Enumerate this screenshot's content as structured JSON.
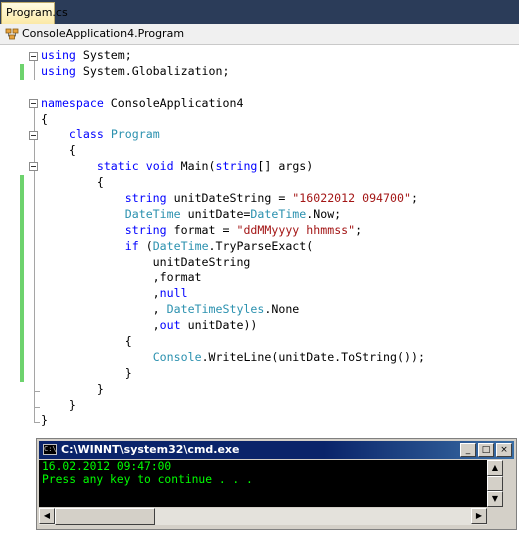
{
  "tab": {
    "label": "Program.cs"
  },
  "navbar": {
    "class_path": "ConsoleApplication4.Program"
  },
  "code_lines": [
    [
      {
        "t": "using",
        "c": "kw"
      },
      {
        "t": " System;"
      }
    ],
    [
      {
        "t": "using",
        "c": "kw"
      },
      {
        "t": " System.Globalization;"
      }
    ],
    [
      {
        "t": ""
      }
    ],
    [
      {
        "t": "namespace",
        "c": "kw"
      },
      {
        "t": " ConsoleApplication4"
      }
    ],
    [
      {
        "t": "{"
      }
    ],
    [
      {
        "t": "    "
      },
      {
        "t": "class",
        "c": "kw"
      },
      {
        "t": " "
      },
      {
        "t": "Program",
        "c": "ty"
      }
    ],
    [
      {
        "t": "    {"
      }
    ],
    [
      {
        "t": "        "
      },
      {
        "t": "static",
        "c": "kw"
      },
      {
        "t": " "
      },
      {
        "t": "void",
        "c": "kw"
      },
      {
        "t": " Main("
      },
      {
        "t": "string",
        "c": "kw"
      },
      {
        "t": "[] args)"
      }
    ],
    [
      {
        "t": "        {"
      }
    ],
    [
      {
        "t": "            "
      },
      {
        "t": "string",
        "c": "kw"
      },
      {
        "t": " unitDateString = "
      },
      {
        "t": "\"16022012 094700\"",
        "c": "st"
      },
      {
        "t": ";"
      }
    ],
    [
      {
        "t": "            "
      },
      {
        "t": "DateTime",
        "c": "ty"
      },
      {
        "t": " unitDate="
      },
      {
        "t": "DateTime",
        "c": "ty"
      },
      {
        "t": ".Now;"
      }
    ],
    [
      {
        "t": "            "
      },
      {
        "t": "string",
        "c": "kw"
      },
      {
        "t": " format = "
      },
      {
        "t": "\"ddMMyyyy hhmmss\"",
        "c": "st"
      },
      {
        "t": ";"
      }
    ],
    [
      {
        "t": "            "
      },
      {
        "t": "if",
        "c": "kw"
      },
      {
        "t": " ("
      },
      {
        "t": "DateTime",
        "c": "ty"
      },
      {
        "t": ".TryParseExact("
      }
    ],
    [
      {
        "t": "                unitDateString"
      }
    ],
    [
      {
        "t": "                ,format"
      }
    ],
    [
      {
        "t": "                ,"
      },
      {
        "t": "null",
        "c": "kw"
      }
    ],
    [
      {
        "t": "                , "
      },
      {
        "t": "DateTimeStyles",
        "c": "ty"
      },
      {
        "t": ".None"
      }
    ],
    [
      {
        "t": "                ,"
      },
      {
        "t": "out",
        "c": "kw"
      },
      {
        "t": " unitDate))"
      }
    ],
    [
      {
        "t": "            {"
      }
    ],
    [
      {
        "t": "                "
      },
      {
        "t": "Console",
        "c": "ty"
      },
      {
        "t": ".WriteLine(unitDate.ToString());"
      }
    ],
    [
      {
        "t": "            }"
      }
    ],
    [
      {
        "t": "        }"
      }
    ],
    [
      {
        "t": "    }"
      }
    ],
    [
      {
        "t": "}"
      }
    ]
  ],
  "console": {
    "title": "C:\\WINNT\\system32\\cmd.exe",
    "icon_text": "C:\\",
    "minimize_glyph": "_",
    "maximize_glyph": "□",
    "close_glyph": "×",
    "output": "16.02.2012 09:47:00\nPress any key to continue . . .",
    "text_color": "#00ff00"
  },
  "colors": {
    "keyword": "#0000ff",
    "type": "#2b91af",
    "string": "#a31515",
    "change_marker": "#6ed36e"
  }
}
